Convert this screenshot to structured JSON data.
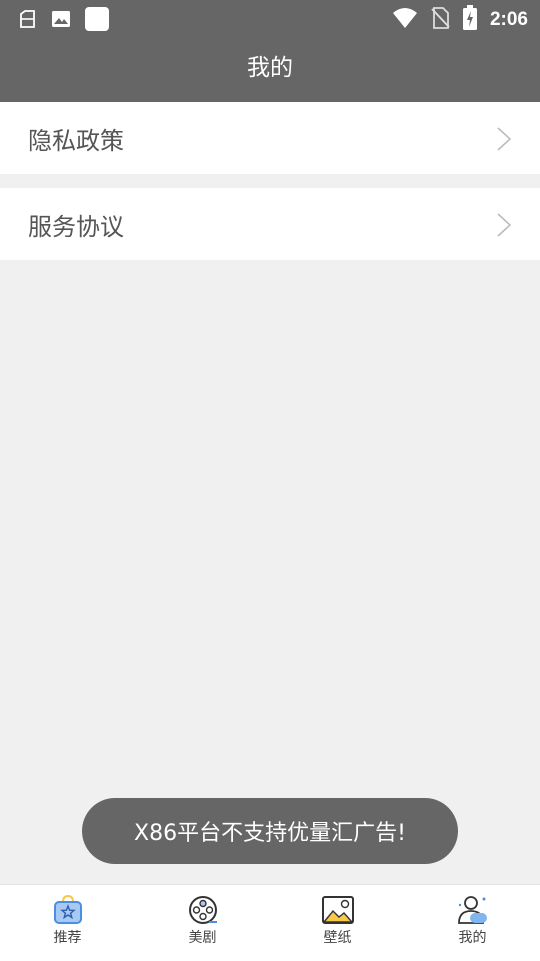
{
  "status_bar": {
    "time": "2:06",
    "icons_left": [
      "storage-icon",
      "image-icon",
      "app-notification-icon"
    ],
    "icons_right": [
      "wifi-icon",
      "no-sim-icon",
      "battery-charging-icon"
    ]
  },
  "header": {
    "title": "我的"
  },
  "menu": {
    "items": [
      {
        "label": "隐私政策"
      },
      {
        "label": "服务协议"
      }
    ]
  },
  "toast": {
    "text": "X86平台不支持优量汇广告!"
  },
  "tabbar": {
    "tabs": [
      {
        "label": "推荐",
        "icon": "recommend-bag-icon"
      },
      {
        "label": "美剧",
        "icon": "film-reel-icon"
      },
      {
        "label": "壁纸",
        "icon": "wallpaper-picture-icon"
      },
      {
        "label": "我的",
        "icon": "profile-user-icon"
      }
    ]
  },
  "colors": {
    "header_bg": "#666666",
    "page_bg": "#f0f0f0",
    "accent_blue": "#4a8fe0",
    "accent_yellow": "#f7c84a"
  }
}
